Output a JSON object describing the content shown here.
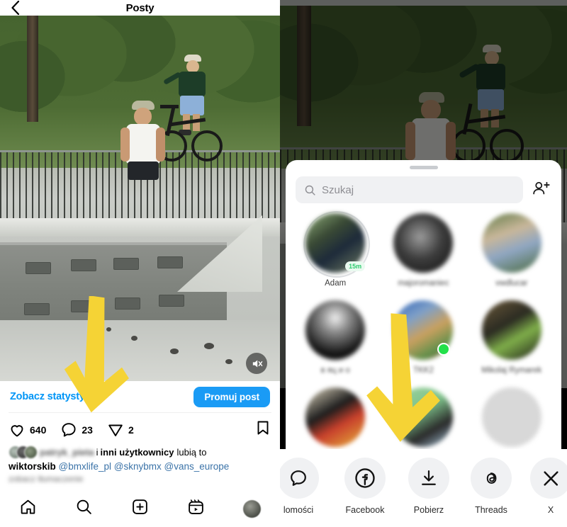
{
  "colors": {
    "accent_blue": "#0095f6",
    "promote_button": "#1a9bf5",
    "annotation_yellow": "#f5d335",
    "online_green": "#23e04a",
    "note_green": "#2ecb6f",
    "sheet_bg": "#ffffff",
    "search_bg": "#f0f1f3"
  },
  "left_panel": {
    "header": {
      "back_icon": "chevron-left-icon",
      "title": "Posty"
    },
    "media": {
      "mute_icon": "speaker-muted-icon"
    },
    "actions": {
      "stats_link": "Zobacz statystyki",
      "promote_button": "Promuj post"
    },
    "engagement": [
      {
        "icon": "heart-icon",
        "count": "640"
      },
      {
        "icon": "comment-icon",
        "count": "23"
      },
      {
        "icon": "share-paperplane-icon",
        "count": "2"
      }
    ],
    "bookmark_icon": "bookmark-icon",
    "likes": {
      "blurred_username": "patryk_pieta",
      "connector": "i",
      "bold_part": "inni użytkownicy",
      "suffix": "lubią to"
    },
    "caption": {
      "author": "wiktorskib",
      "tags": [
        "@bmxlife_pl",
        "@sknybmx",
        "@vans_europe"
      ],
      "blurred_second_line": "zobacz tłumaczenie"
    },
    "tabbar": [
      {
        "icon": "home-icon",
        "label": "Home"
      },
      {
        "icon": "search-icon",
        "label": "Search"
      },
      {
        "icon": "plus-square-icon",
        "label": "Create"
      },
      {
        "icon": "reels-icon",
        "label": "Reels"
      },
      {
        "icon": "profile-avatar",
        "label": "Profile"
      }
    ]
  },
  "right_panel": {
    "sheet": {
      "grabber": "drag-handle",
      "search": {
        "icon": "search-icon",
        "placeholder": "Szukaj",
        "add_person_icon": "add-person-icon"
      },
      "contacts": [
        {
          "name": "Adam",
          "blurred": false,
          "note_badge": "15m",
          "has_ring": true,
          "online": false
        },
        {
          "name": "majoromaniec",
          "blurred": true,
          "note_badge": "",
          "has_ring": false,
          "online": false
        },
        {
          "name": "vwdlucar",
          "blurred": true,
          "note_badge": "",
          "has_ring": false,
          "online": false
        },
        {
          "name": "в яц и о",
          "blurred": true,
          "note_badge": "",
          "has_ring": false,
          "online": false
        },
        {
          "name": "TKK2",
          "blurred": true,
          "note_badge": "",
          "has_ring": false,
          "online": true
        },
        {
          "name": "Mikolaj Rymarek",
          "blurred": true,
          "note_badge": "",
          "has_ring": false,
          "online": false
        }
      ]
    },
    "share_targets": [
      {
        "icon": "messages-chat-icon",
        "label": "lomości"
      },
      {
        "icon": "facebook-icon",
        "label": "Facebook"
      },
      {
        "icon": "download-icon",
        "label": "Pobierz"
      },
      {
        "icon": "threads-icon",
        "label": "Threads"
      },
      {
        "icon": "x-twitter-icon",
        "label": "X"
      }
    ]
  },
  "annotations": [
    {
      "name": "arrow-pointing-to-statistics",
      "color": "#f5d335"
    },
    {
      "name": "arrow-pointing-to-download",
      "color": "#f5d335"
    }
  ]
}
